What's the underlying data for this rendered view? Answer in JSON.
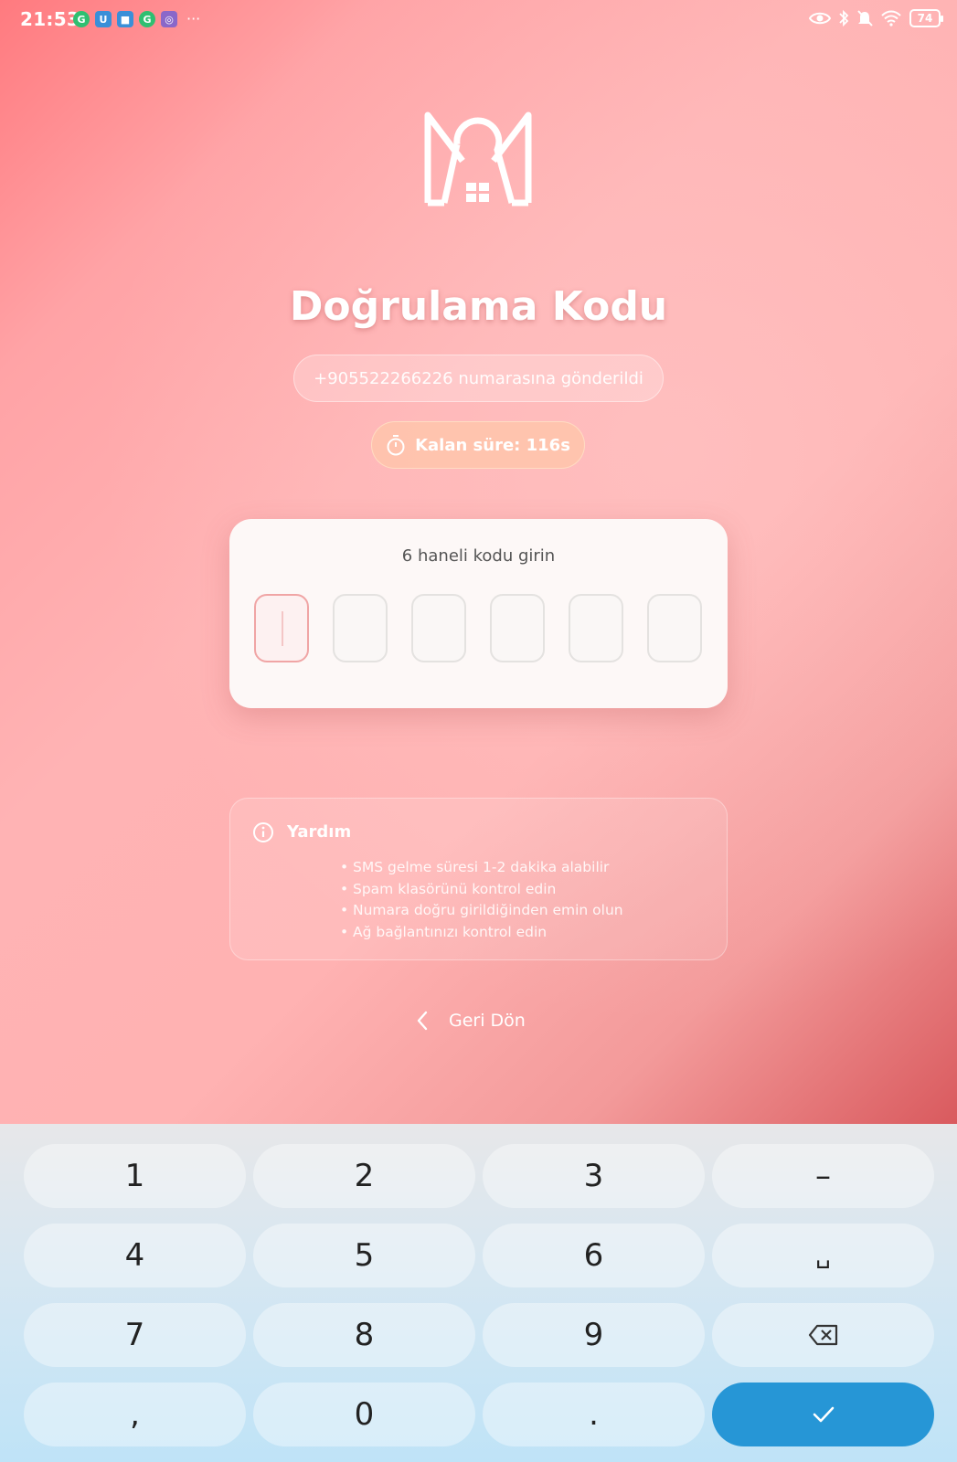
{
  "status_bar": {
    "time": "21:53",
    "notification_icons": [
      "G",
      "U",
      "■",
      "G",
      "◎"
    ],
    "more": "···",
    "battery": "74"
  },
  "page": {
    "title": "Doğrulama Kodu",
    "phone_message": "+905522266226 numarasına gönderildi",
    "timer_text": "Kalan süre: 116s",
    "code_label": "6 haneli kodu girin",
    "code_length": 6,
    "help_title": "Yardım",
    "help_items": [
      "SMS gelme süresi 1-2 dakika alabilir",
      "Spam klasörünü kontrol edin",
      "Numara doğru girildiğinden emin olun",
      "Ağ bağlantınızı kontrol edin"
    ],
    "back_label": "Geri Dön"
  },
  "keyboard": {
    "keys": [
      "1",
      "2",
      "3",
      "–",
      "4",
      "5",
      "6",
      "␣",
      "7",
      "8",
      "9",
      "⌫",
      ",",
      "0",
      ".",
      "✓"
    ]
  },
  "colors": {
    "accent": "#2696d6",
    "background_gradient_start": "#ff7a7f",
    "background_gradient_end": "#d95a5e",
    "timer_pill": "#ffc7aa",
    "active_box_border": "#f0a5a5"
  }
}
